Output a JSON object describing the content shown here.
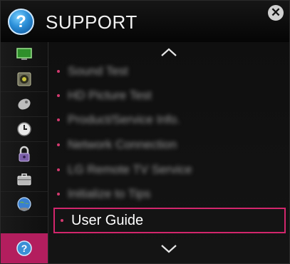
{
  "header": {
    "icon": "help-question-icon",
    "title": "SUPPORT",
    "close_icon": "close-icon",
    "close_glyph": "✕"
  },
  "sidebar": {
    "items": [
      {
        "icon": "picture-tv-icon"
      },
      {
        "icon": "audio-speaker-icon"
      },
      {
        "icon": "channel-satellite-dish-icon"
      },
      {
        "icon": "time-clock-icon"
      },
      {
        "icon": "lock-icon"
      },
      {
        "icon": "option-toolbox-icon"
      },
      {
        "icon": "network-globe-icon"
      },
      {
        "icon": "support-question-icon",
        "active": true
      }
    ]
  },
  "menu": {
    "up_arrow": "chevron-up-icon",
    "down_arrow": "chevron-down-icon",
    "items": [
      {
        "label": "Sound Test",
        "blurred": true
      },
      {
        "label": "HD Picture Test",
        "blurred": true
      },
      {
        "label": "Product/Service Info.",
        "blurred": true
      },
      {
        "label": "Network Connection",
        "blurred": true
      },
      {
        "label": "LG Remote TV Service",
        "blurred": true
      },
      {
        "label": "Initialize to Tips",
        "blurred": true
      }
    ],
    "selected": {
      "label": "User Guide"
    }
  },
  "colors": {
    "accent": "#d2266c",
    "sidebar_active": "#b31e5e",
    "background": "#0f0f0f"
  }
}
